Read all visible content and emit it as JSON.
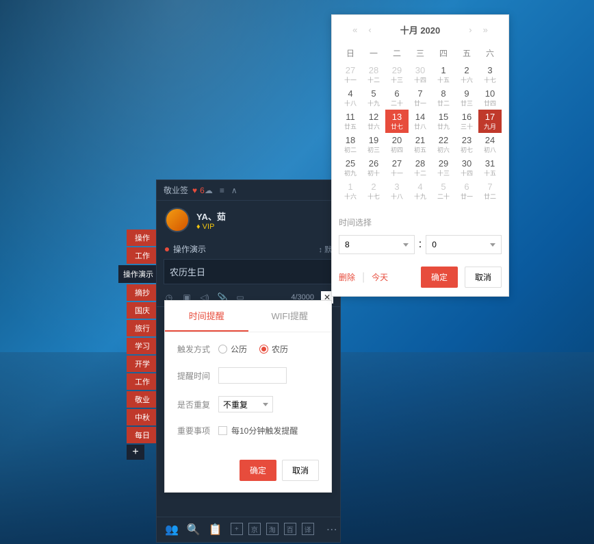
{
  "sideTabs": {
    "items": [
      "操作",
      "工作",
      "操作演示",
      "摘抄",
      "国庆",
      "旅行",
      "学习",
      "开学",
      "工作",
      "敬业",
      "中秋",
      "每日"
    ],
    "activeIndex": 2
  },
  "panel": {
    "appName": "敬业签",
    "badgeCount": "6",
    "userName": "YA、茹",
    "vipLabel": "VIP",
    "sectionTitle": "操作演示",
    "sectionRight": "↕ 默",
    "inputValue": "农历生日",
    "counter": "4/3000",
    "bottomBtns": [
      "京",
      "淘",
      "百",
      "译"
    ]
  },
  "reminder": {
    "tabs": [
      "时间提醒",
      "WIFI提醒"
    ],
    "activeTab": 0,
    "labels": {
      "trigger": "触发方式",
      "time": "提醒时间",
      "repeat": "是否重复",
      "important": "重要事项"
    },
    "radioOptions": [
      "公历",
      "农历"
    ],
    "radioSelected": 1,
    "repeatValue": "不重复",
    "importantText": "每10分钟触发提醒",
    "confirm": "确定",
    "cancel": "取消"
  },
  "calendar": {
    "title": "十月 2020",
    "weekdays": [
      "日",
      "一",
      "二",
      "三",
      "四",
      "五",
      "六"
    ],
    "days": [
      [
        {
          "n": "27",
          "l": "十一",
          "o": true
        },
        {
          "n": "28",
          "l": "十二",
          "o": true
        },
        {
          "n": "29",
          "l": "十三",
          "o": true
        },
        {
          "n": "30",
          "l": "十四",
          "o": true
        },
        {
          "n": "1",
          "l": "十五"
        },
        {
          "n": "2",
          "l": "十六"
        },
        {
          "n": "3",
          "l": "十七"
        }
      ],
      [
        {
          "n": "4",
          "l": "十八"
        },
        {
          "n": "5",
          "l": "十九"
        },
        {
          "n": "6",
          "l": "二十"
        },
        {
          "n": "7",
          "l": "廿一"
        },
        {
          "n": "8",
          "l": "廿二"
        },
        {
          "n": "9",
          "l": "廿三"
        },
        {
          "n": "10",
          "l": "廿四"
        }
      ],
      [
        {
          "n": "11",
          "l": "廿五"
        },
        {
          "n": "12",
          "l": "廿六"
        },
        {
          "n": "13",
          "l": "廿七",
          "sel": true
        },
        {
          "n": "14",
          "l": "廿八"
        },
        {
          "n": "15",
          "l": "廿九"
        },
        {
          "n": "16",
          "l": "三十"
        },
        {
          "n": "17",
          "l": "九月",
          "today": true
        }
      ],
      [
        {
          "n": "18",
          "l": "初二"
        },
        {
          "n": "19",
          "l": "初三"
        },
        {
          "n": "20",
          "l": "初四"
        },
        {
          "n": "21",
          "l": "初五"
        },
        {
          "n": "22",
          "l": "初六"
        },
        {
          "n": "23",
          "l": "初七"
        },
        {
          "n": "24",
          "l": "初八"
        }
      ],
      [
        {
          "n": "25",
          "l": "初九"
        },
        {
          "n": "26",
          "l": "初十"
        },
        {
          "n": "27",
          "l": "十一"
        },
        {
          "n": "28",
          "l": "十二"
        },
        {
          "n": "29",
          "l": "十三"
        },
        {
          "n": "30",
          "l": "十四"
        },
        {
          "n": "31",
          "l": "十五"
        }
      ],
      [
        {
          "n": "1",
          "l": "十六",
          "o": true
        },
        {
          "n": "2",
          "l": "十七",
          "o": true
        },
        {
          "n": "3",
          "l": "十八",
          "o": true
        },
        {
          "n": "4",
          "l": "十九",
          "o": true
        },
        {
          "n": "5",
          "l": "二十",
          "o": true
        },
        {
          "n": "6",
          "l": "廿一",
          "o": true
        },
        {
          "n": "7",
          "l": "廿二",
          "o": true
        }
      ]
    ],
    "timeLabel": "时间选择",
    "hour": "8",
    "minute": "0",
    "deleteLabel": "删除",
    "todayLabel": "今天",
    "confirm": "确定",
    "cancel": "取消"
  }
}
